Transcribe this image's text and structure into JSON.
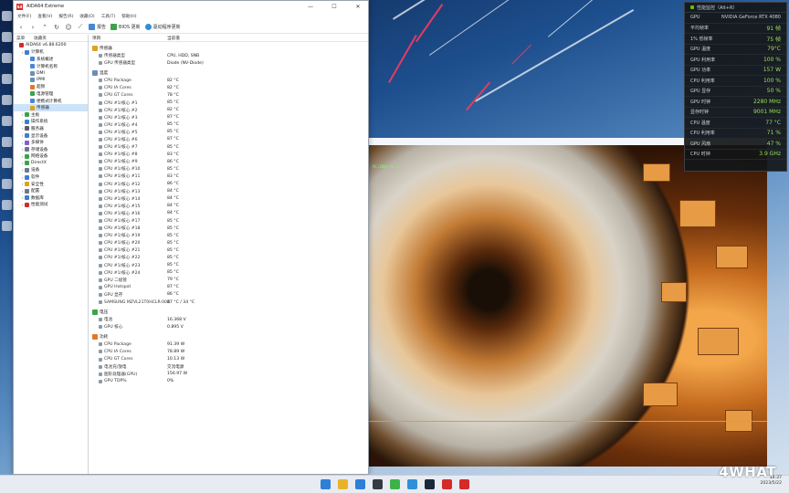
{
  "window": {
    "title": "AIDA64 Extreme",
    "controls": {
      "minimize": "—",
      "maximize": "☐",
      "close": "✕"
    }
  },
  "menu": [
    "文件(F)",
    "查看(V)",
    "报告(R)",
    "收藏(O)",
    "工具(T)",
    "帮助(H)"
  ],
  "toolbar": {
    "report_label": "报告",
    "bios_label": "BIOS 更新",
    "driver_label": "驱动程序更新"
  },
  "left_panel": {
    "tabs": [
      "菜单",
      "收藏夹"
    ],
    "tree": [
      {
        "label": "AIDA64 v6.88.6200",
        "level": 0,
        "icon": "aida-logo-icon",
        "color": "#d42a2a"
      },
      {
        "label": "计算机",
        "level": 1,
        "icon": "computer-icon",
        "color": "#3b7fd4"
      },
      {
        "label": "系统概述",
        "level": 2,
        "icon": "summary-icon",
        "color": "#4a86d8"
      },
      {
        "label": "计算机名称",
        "level": 2,
        "icon": "computer-name-icon",
        "color": "#4a86d8"
      },
      {
        "label": "DMI",
        "level": 2,
        "icon": "dmi-icon",
        "color": "#6b8fb5"
      },
      {
        "label": "IPMI",
        "level": 2,
        "icon": "ipmi-icon",
        "color": "#6b8fb5"
      },
      {
        "label": "超频",
        "level": 2,
        "icon": "overclock-icon",
        "color": "#e0792a"
      },
      {
        "label": "电源管理",
        "level": 2,
        "icon": "power-icon",
        "color": "#3ca34a"
      },
      {
        "label": "便携式计算机",
        "level": 2,
        "icon": "laptop-icon",
        "color": "#4a86d8"
      },
      {
        "label": "传感器",
        "level": 2,
        "icon": "sensor-icon",
        "color": "#e0a020",
        "selected": true
      },
      {
        "label": "主板",
        "level": 1,
        "icon": "motherboard-icon",
        "color": "#3ca34a"
      },
      {
        "label": "操作系统",
        "level": 1,
        "icon": "os-icon",
        "color": "#3b7fd4"
      },
      {
        "label": "服务器",
        "level": 1,
        "icon": "server-icon",
        "color": "#555f6b"
      },
      {
        "label": "显示设备",
        "level": 1,
        "icon": "display-icon",
        "color": "#3b7fd4"
      },
      {
        "label": "多媒体",
        "level": 1,
        "icon": "multimedia-icon",
        "color": "#8a5ad0"
      },
      {
        "label": "存储设备",
        "level": 1,
        "icon": "storage-icon",
        "color": "#6b7a88"
      },
      {
        "label": "网络设备",
        "level": 1,
        "icon": "network-icon",
        "color": "#3ca34a"
      },
      {
        "label": "DirectX",
        "level": 1,
        "icon": "directx-icon",
        "color": "#3ca34a"
      },
      {
        "label": "设备",
        "level": 1,
        "icon": "devices-icon",
        "color": "#6b7a88"
      },
      {
        "label": "软件",
        "level": 1,
        "icon": "software-icon",
        "color": "#3b7fd4"
      },
      {
        "label": "安全性",
        "level": 1,
        "icon": "security-icon",
        "color": "#e0a020"
      },
      {
        "label": "配置",
        "level": 1,
        "icon": "config-icon",
        "color": "#6b7a88"
      },
      {
        "label": "数据库",
        "level": 1,
        "icon": "database-icon",
        "color": "#3b7fd4"
      },
      {
        "label": "性能测试",
        "level": 1,
        "icon": "benchmark-icon",
        "color": "#d42a2a"
      }
    ]
  },
  "list_header": {
    "item": "项目",
    "value": "当前值"
  },
  "sections": [
    {
      "title": "传感器",
      "icon": "sensor-icon",
      "color": "#e0a020",
      "rows": [
        {
          "name": "传感器类型",
          "value": "CPU, HDD, SNB",
          "icon": "sensor-type-icon"
        },
        {
          "name": "GPU 传感器类型",
          "value": "Diode (NV-Diode)",
          "icon": "gpu-sensor-icon"
        }
      ]
    },
    {
      "title": "温度",
      "icon": "temperature-icon",
      "color": "#6b8fb5",
      "rows": [
        {
          "name": "CPU Package",
          "value": "82 °C"
        },
        {
          "name": "CPU IA Cores",
          "value": "82 °C"
        },
        {
          "name": "CPU GT Cores",
          "value": "78 °C"
        },
        {
          "name": "CPU #1/核心 #1",
          "value": "85 °C"
        },
        {
          "name": "CPU #1/核心 #2",
          "value": "82 °C"
        },
        {
          "name": "CPU #1/核心 #3",
          "value": "87 °C"
        },
        {
          "name": "CPU #1/核心 #4",
          "value": "85 °C"
        },
        {
          "name": "CPU #1/核心 #5",
          "value": "85 °C"
        },
        {
          "name": "CPU #1/核心 #6",
          "value": "87 °C"
        },
        {
          "name": "CPU #1/核心 #7",
          "value": "85 °C"
        },
        {
          "name": "CPU #1/核心 #8",
          "value": "83 °C"
        },
        {
          "name": "CPU #1/核心 #9",
          "value": "86 °C"
        },
        {
          "name": "CPU #1/核心 #10",
          "value": "85 °C"
        },
        {
          "name": "CPU #1/核心 #11",
          "value": "83 °C"
        },
        {
          "name": "CPU #1/核心 #12",
          "value": "86 °C"
        },
        {
          "name": "CPU #1/核心 #13",
          "value": "84 °C"
        },
        {
          "name": "CPU #1/核心 #14",
          "value": "84 °C"
        },
        {
          "name": "CPU #1/核心 #15",
          "value": "84 °C"
        },
        {
          "name": "CPU #1/核心 #16",
          "value": "84 °C"
        },
        {
          "name": "CPU #1/核心 #17",
          "value": "85 °C"
        },
        {
          "name": "CPU #1/核心 #18",
          "value": "85 °C"
        },
        {
          "name": "CPU #1/核心 #19",
          "value": "85 °C"
        },
        {
          "name": "CPU #1/核心 #20",
          "value": "85 °C"
        },
        {
          "name": "CPU #1/核心 #21",
          "value": "85 °C"
        },
        {
          "name": "CPU #1/核心 #22",
          "value": "85 °C"
        },
        {
          "name": "CPU #1/核心 #23",
          "value": "85 °C"
        },
        {
          "name": "CPU #1/核心 #24",
          "value": "85 °C"
        },
        {
          "name": "GPU 二极管",
          "value": "79 °C"
        },
        {
          "name": "GPU Hotspot",
          "value": "87 °C"
        },
        {
          "name": "GPU 显存",
          "value": "86 °C"
        },
        {
          "name": "SAMSUNG MZVL21T0HCLR-00B",
          "value": "47 °C / 34 °C"
        }
      ]
    },
    {
      "title": "电压",
      "icon": "voltage-icon",
      "color": "#3ca34a",
      "rows": [
        {
          "name": "电池",
          "value": "16.368 V"
        },
        {
          "name": "GPU 核心",
          "value": "0.895 V"
        }
      ]
    },
    {
      "title": "功耗",
      "icon": "power-value-icon",
      "color": "#e0792a",
      "rows": [
        {
          "name": "CPU Package",
          "value": "91.39 W"
        },
        {
          "name": "CPU IA Cores",
          "value": "78.89 W"
        },
        {
          "name": "CPU GT Cores",
          "value": "10.13 W"
        },
        {
          "name": "电池充/放电",
          "value": "交流电源"
        },
        {
          "name": "图形处理器(GPU)",
          "value": "156.97 W"
        },
        {
          "name": "GPU TDP%",
          "value": "0%"
        }
      ]
    }
  ],
  "overlay": {
    "title": "性能监控（Alt+R）",
    "rows": [
      {
        "label": "GPU",
        "value": "NVIDIA GeForce RTX 4080"
      },
      {
        "label": "平均帧率",
        "value": "91 帧"
      },
      {
        "label": "1% 低帧率",
        "value": "75 帧"
      },
      {
        "label": "GPU 温度",
        "value": "79°C"
      },
      {
        "label": "GPU 利用率",
        "value": "100 %"
      },
      {
        "label": "GPU 功率",
        "value": "157 W"
      },
      {
        "label": "CPU 利用率",
        "value": "100 %"
      },
      {
        "label": "GPU 显存",
        "value": "50 %"
      },
      {
        "label": "GPU 时钟",
        "value": "2280 MHz"
      },
      {
        "label": "显存时钟",
        "value": "9001 MHz"
      },
      {
        "label": "CPU 温度",
        "value": "77 °C"
      },
      {
        "label": "CPU 利用率",
        "value": "71 %"
      },
      {
        "label": "GPU 风扇",
        "value": "47 %"
      },
      {
        "label": "CPU 时钟",
        "value": "3.9 GHz"
      }
    ]
  },
  "render_hud": "PL:100% FL:0",
  "taskbar": {
    "icons": [
      {
        "name": "start-icon",
        "color": "#2f7ed8"
      },
      {
        "name": "explorer-icon",
        "color": "#e8b32a"
      },
      {
        "name": "store-icon",
        "color": "#2f7ed8"
      },
      {
        "name": "terminal-icon",
        "color": "#333a44"
      },
      {
        "name": "wechat-icon",
        "color": "#3cb34a"
      },
      {
        "name": "browser-icon",
        "color": "#2f8fd8"
      },
      {
        "name": "steam-icon",
        "color": "#1b2838"
      },
      {
        "name": "game-icon",
        "color": "#d42a2a"
      },
      {
        "name": "aida64-taskbar-icon",
        "color": "#d42a2a"
      }
    ],
    "clock_time": "14:37",
    "clock_date": "2023/5/22"
  },
  "watermark": "4WHAT"
}
